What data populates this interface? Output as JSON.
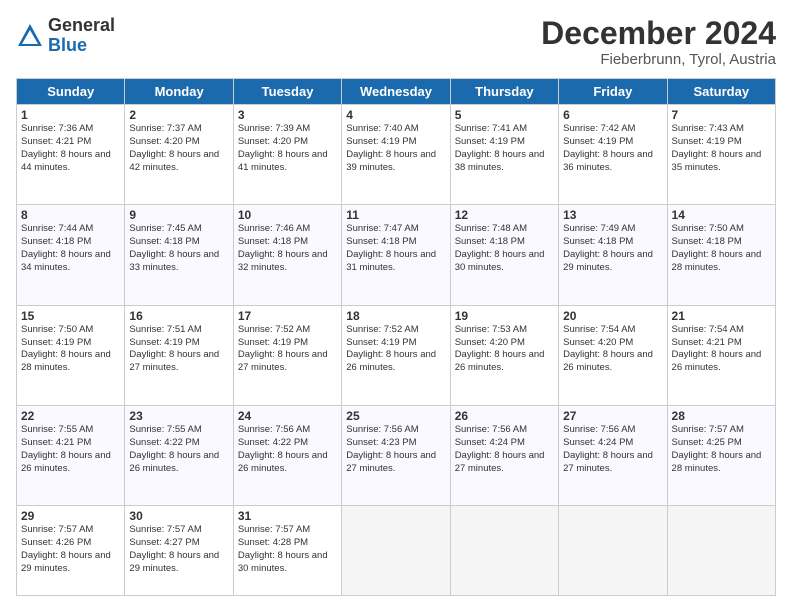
{
  "header": {
    "logo_general": "General",
    "logo_blue": "Blue",
    "month_title": "December 2024",
    "location": "Fieberbrunn, Tyrol, Austria"
  },
  "weekdays": [
    "Sunday",
    "Monday",
    "Tuesday",
    "Wednesday",
    "Thursday",
    "Friday",
    "Saturday"
  ],
  "weeks": [
    [
      {
        "day": "1",
        "sunrise": "Sunrise: 7:36 AM",
        "sunset": "Sunset: 4:21 PM",
        "daylight": "Daylight: 8 hours and 44 minutes."
      },
      {
        "day": "2",
        "sunrise": "Sunrise: 7:37 AM",
        "sunset": "Sunset: 4:20 PM",
        "daylight": "Daylight: 8 hours and 42 minutes."
      },
      {
        "day": "3",
        "sunrise": "Sunrise: 7:39 AM",
        "sunset": "Sunset: 4:20 PM",
        "daylight": "Daylight: 8 hours and 41 minutes."
      },
      {
        "day": "4",
        "sunrise": "Sunrise: 7:40 AM",
        "sunset": "Sunset: 4:19 PM",
        "daylight": "Daylight: 8 hours and 39 minutes."
      },
      {
        "day": "5",
        "sunrise": "Sunrise: 7:41 AM",
        "sunset": "Sunset: 4:19 PM",
        "daylight": "Daylight: 8 hours and 38 minutes."
      },
      {
        "day": "6",
        "sunrise": "Sunrise: 7:42 AM",
        "sunset": "Sunset: 4:19 PM",
        "daylight": "Daylight: 8 hours and 36 minutes."
      },
      {
        "day": "7",
        "sunrise": "Sunrise: 7:43 AM",
        "sunset": "Sunset: 4:19 PM",
        "daylight": "Daylight: 8 hours and 35 minutes."
      }
    ],
    [
      {
        "day": "8",
        "sunrise": "Sunrise: 7:44 AM",
        "sunset": "Sunset: 4:18 PM",
        "daylight": "Daylight: 8 hours and 34 minutes."
      },
      {
        "day": "9",
        "sunrise": "Sunrise: 7:45 AM",
        "sunset": "Sunset: 4:18 PM",
        "daylight": "Daylight: 8 hours and 33 minutes."
      },
      {
        "day": "10",
        "sunrise": "Sunrise: 7:46 AM",
        "sunset": "Sunset: 4:18 PM",
        "daylight": "Daylight: 8 hours and 32 minutes."
      },
      {
        "day": "11",
        "sunrise": "Sunrise: 7:47 AM",
        "sunset": "Sunset: 4:18 PM",
        "daylight": "Daylight: 8 hours and 31 minutes."
      },
      {
        "day": "12",
        "sunrise": "Sunrise: 7:48 AM",
        "sunset": "Sunset: 4:18 PM",
        "daylight": "Daylight: 8 hours and 30 minutes."
      },
      {
        "day": "13",
        "sunrise": "Sunrise: 7:49 AM",
        "sunset": "Sunset: 4:18 PM",
        "daylight": "Daylight: 8 hours and 29 minutes."
      },
      {
        "day": "14",
        "sunrise": "Sunrise: 7:50 AM",
        "sunset": "Sunset: 4:18 PM",
        "daylight": "Daylight: 8 hours and 28 minutes."
      }
    ],
    [
      {
        "day": "15",
        "sunrise": "Sunrise: 7:50 AM",
        "sunset": "Sunset: 4:19 PM",
        "daylight": "Daylight: 8 hours and 28 minutes."
      },
      {
        "day": "16",
        "sunrise": "Sunrise: 7:51 AM",
        "sunset": "Sunset: 4:19 PM",
        "daylight": "Daylight: 8 hours and 27 minutes."
      },
      {
        "day": "17",
        "sunrise": "Sunrise: 7:52 AM",
        "sunset": "Sunset: 4:19 PM",
        "daylight": "Daylight: 8 hours and 27 minutes."
      },
      {
        "day": "18",
        "sunrise": "Sunrise: 7:52 AM",
        "sunset": "Sunset: 4:19 PM",
        "daylight": "Daylight: 8 hours and 26 minutes."
      },
      {
        "day": "19",
        "sunrise": "Sunrise: 7:53 AM",
        "sunset": "Sunset: 4:20 PM",
        "daylight": "Daylight: 8 hours and 26 minutes."
      },
      {
        "day": "20",
        "sunrise": "Sunrise: 7:54 AM",
        "sunset": "Sunset: 4:20 PM",
        "daylight": "Daylight: 8 hours and 26 minutes."
      },
      {
        "day": "21",
        "sunrise": "Sunrise: 7:54 AM",
        "sunset": "Sunset: 4:21 PM",
        "daylight": "Daylight: 8 hours and 26 minutes."
      }
    ],
    [
      {
        "day": "22",
        "sunrise": "Sunrise: 7:55 AM",
        "sunset": "Sunset: 4:21 PM",
        "daylight": "Daylight: 8 hours and 26 minutes."
      },
      {
        "day": "23",
        "sunrise": "Sunrise: 7:55 AM",
        "sunset": "Sunset: 4:22 PM",
        "daylight": "Daylight: 8 hours and 26 minutes."
      },
      {
        "day": "24",
        "sunrise": "Sunrise: 7:56 AM",
        "sunset": "Sunset: 4:22 PM",
        "daylight": "Daylight: 8 hours and 26 minutes."
      },
      {
        "day": "25",
        "sunrise": "Sunrise: 7:56 AM",
        "sunset": "Sunset: 4:23 PM",
        "daylight": "Daylight: 8 hours and 27 minutes."
      },
      {
        "day": "26",
        "sunrise": "Sunrise: 7:56 AM",
        "sunset": "Sunset: 4:24 PM",
        "daylight": "Daylight: 8 hours and 27 minutes."
      },
      {
        "day": "27",
        "sunrise": "Sunrise: 7:56 AM",
        "sunset": "Sunset: 4:24 PM",
        "daylight": "Daylight: 8 hours and 27 minutes."
      },
      {
        "day": "28",
        "sunrise": "Sunrise: 7:57 AM",
        "sunset": "Sunset: 4:25 PM",
        "daylight": "Daylight: 8 hours and 28 minutes."
      }
    ],
    [
      {
        "day": "29",
        "sunrise": "Sunrise: 7:57 AM",
        "sunset": "Sunset: 4:26 PM",
        "daylight": "Daylight: 8 hours and 29 minutes."
      },
      {
        "day": "30",
        "sunrise": "Sunrise: 7:57 AM",
        "sunset": "Sunset: 4:27 PM",
        "daylight": "Daylight: 8 hours and 29 minutes."
      },
      {
        "day": "31",
        "sunrise": "Sunrise: 7:57 AM",
        "sunset": "Sunset: 4:28 PM",
        "daylight": "Daylight: 8 hours and 30 minutes."
      },
      null,
      null,
      null,
      null
    ]
  ]
}
